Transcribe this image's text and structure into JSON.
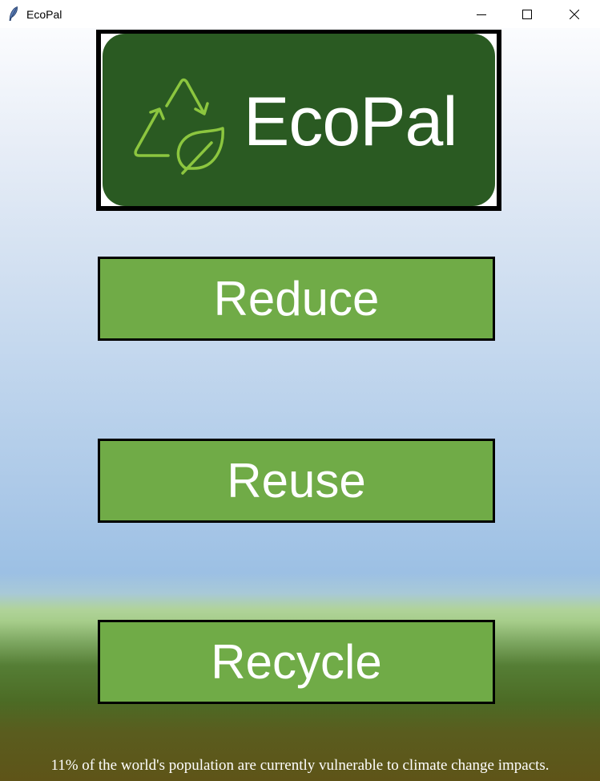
{
  "window": {
    "title": "EcoPal",
    "icon": "feather-icon",
    "controls": {
      "minimize": "minimize-icon",
      "maximize": "maximize-icon",
      "close": "close-icon"
    }
  },
  "logo": {
    "text": "EcoPal",
    "icon": "recycle-leaf-icon",
    "colors": {
      "panel": "#2a5a22",
      "symbol": "#8cc63f",
      "text": "#ffffff"
    }
  },
  "buttons": {
    "reduce": "Reduce",
    "reuse": "Reuse",
    "recycle": "Recycle",
    "colors": {
      "fill": "#70ab47",
      "border": "#000000",
      "text": "#ffffff"
    }
  },
  "footer": {
    "fact": "11% of the world's population are currently vulnerable to climate change impacts."
  }
}
